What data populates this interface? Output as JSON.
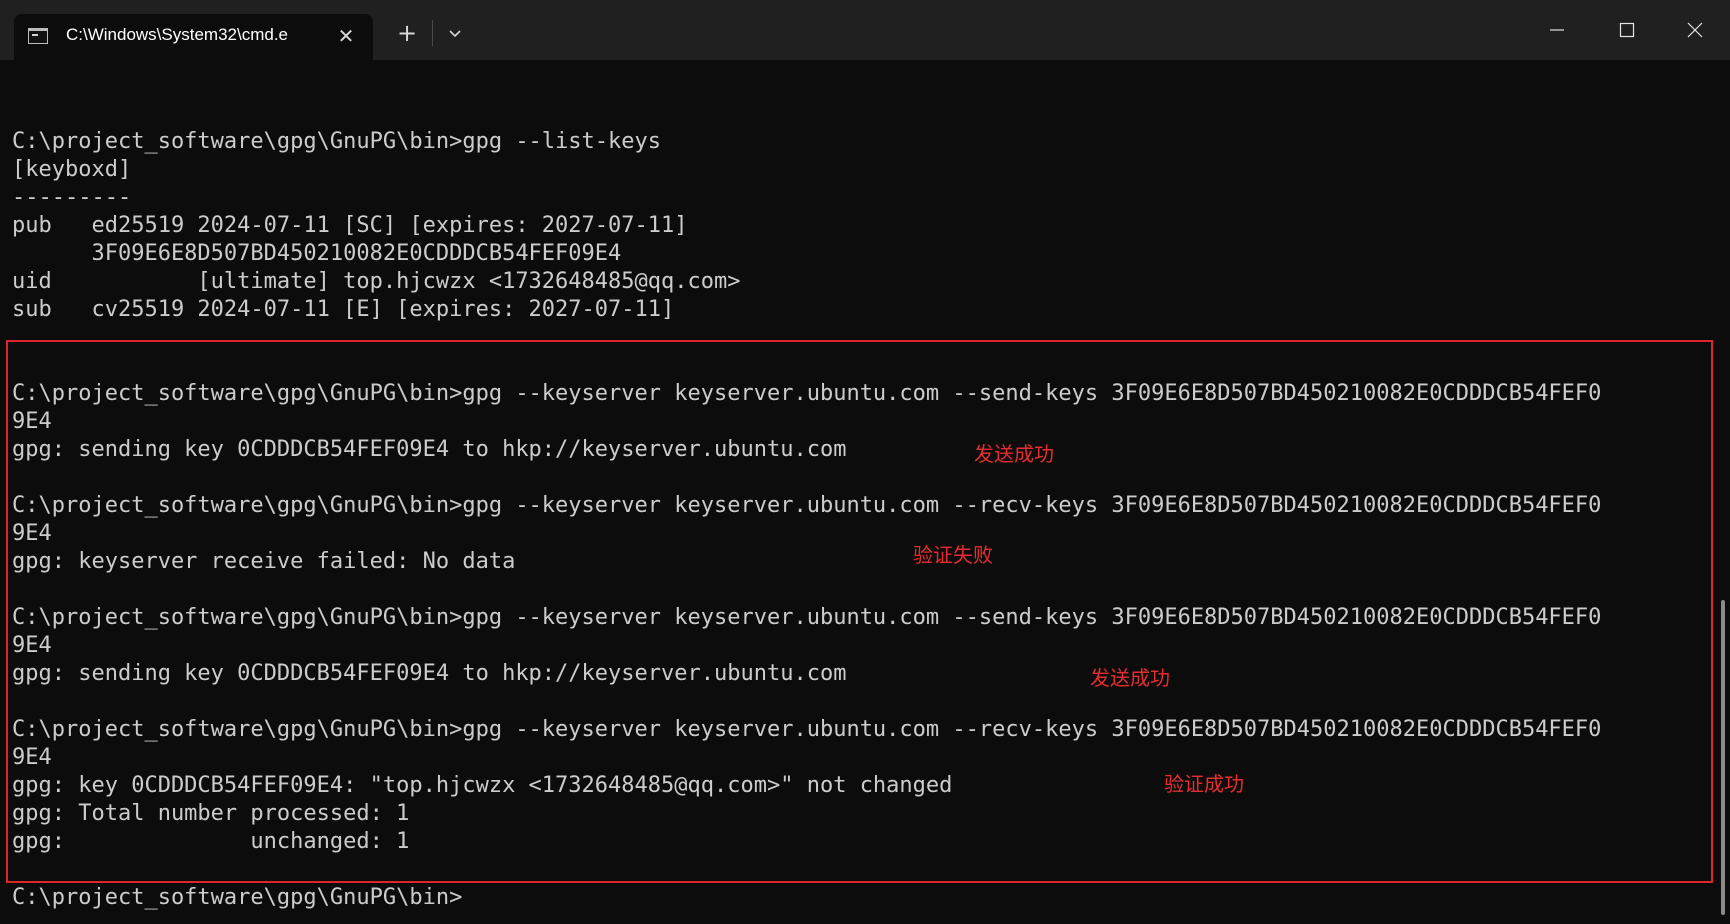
{
  "window": {
    "tab_title": "C:\\Windows\\System32\\cmd.e",
    "tab_icon": "terminal-icon",
    "new_tab_label": "+",
    "close_tab_label": "✕"
  },
  "terminal": {
    "lines": [
      "C:\\project_software\\gpg\\GnuPG\\bin>gpg --list-keys",
      "[keyboxd]",
      "---------",
      "pub   ed25519 2024-07-11 [SC] [expires: 2027-07-11]",
      "      3F09E6E8D507BD450210082E0CDDDCB54FEF09E4",
      "uid           [ultimate] top.hjcwzx <1732648485@qq.com>",
      "sub   cv25519 2024-07-11 [E] [expires: 2027-07-11]",
      "",
      "",
      "C:\\project_software\\gpg\\GnuPG\\bin>gpg --keyserver keyserver.ubuntu.com --send-keys 3F09E6E8D507BD450210082E0CDDDCB54FEF0",
      "9E4",
      "gpg: sending key 0CDDDCB54FEF09E4 to hkp://keyserver.ubuntu.com",
      "",
      "C:\\project_software\\gpg\\GnuPG\\bin>gpg --keyserver keyserver.ubuntu.com --recv-keys 3F09E6E8D507BD450210082E0CDDDCB54FEF0",
      "9E4",
      "gpg: keyserver receive failed: No data",
      "",
      "C:\\project_software\\gpg\\GnuPG\\bin>gpg --keyserver keyserver.ubuntu.com --send-keys 3F09E6E8D507BD450210082E0CDDDCB54FEF0",
      "9E4",
      "gpg: sending key 0CDDDCB54FEF09E4 to hkp://keyserver.ubuntu.com",
      "",
      "C:\\project_software\\gpg\\GnuPG\\bin>gpg --keyserver keyserver.ubuntu.com --recv-keys 3F09E6E8D507BD450210082E0CDDDCB54FEF0",
      "9E4",
      "gpg: key 0CDDDCB54FEF09E4: \"top.hjcwzx <1732648485@qq.com>\" not changed",
      "gpg: Total number processed: 1",
      "gpg:              unchanged: 1",
      "",
      "C:\\project_software\\gpg\\GnuPG\\bin>"
    ]
  },
  "annotations": {
    "note_1": "发送成功",
    "note_2": "验证失败",
    "note_3": "发送成功",
    "note_4": "验证成功",
    "color": "#e0242b"
  },
  "colors": {
    "background": "#0c0c0c",
    "titlebar": "#202020",
    "text": "#cccccc"
  }
}
